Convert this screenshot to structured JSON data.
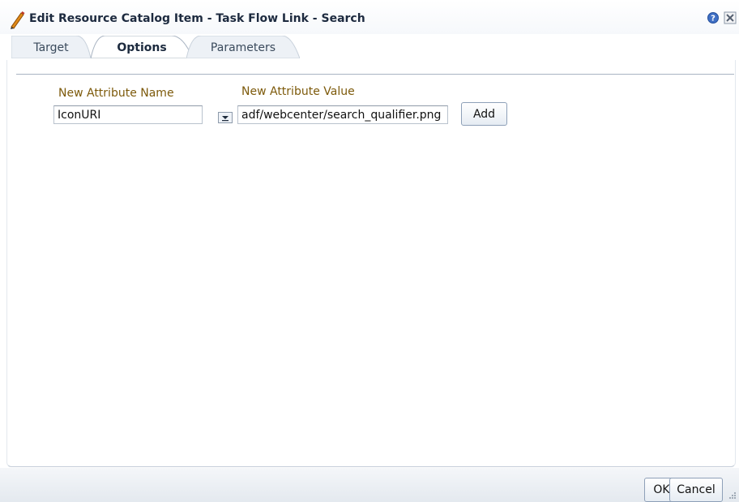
{
  "dialog": {
    "title": "Edit Resource Catalog Item - Task Flow Link - Search",
    "icons": {
      "title": "pencil-icon",
      "help": "help-icon",
      "close": "close-icon"
    }
  },
  "tabs": [
    {
      "label": "Target",
      "active": false
    },
    {
      "label": "Options",
      "active": true
    },
    {
      "label": "Parameters",
      "active": false
    }
  ],
  "form": {
    "name_label": "New Attribute Name",
    "value_label": "New Attribute Value",
    "name_value": "IconURI",
    "value_value": "adf/webcenter/search_qualifier.png",
    "add_label": "Add"
  },
  "footer": {
    "ok_label": "OK",
    "cancel_label": "Cancel"
  },
  "colors": {
    "label_text": "#7d5a0b",
    "title_text": "#1d2a3f",
    "tab_border": "#a9b4c2"
  }
}
